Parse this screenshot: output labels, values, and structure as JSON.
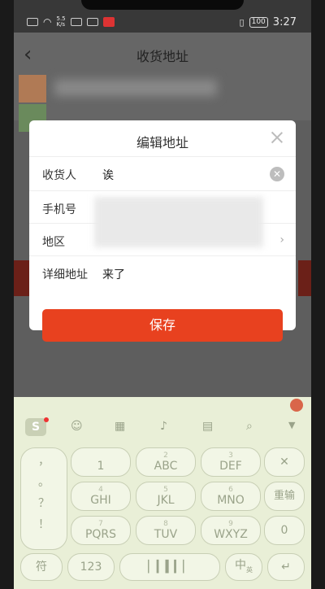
{
  "status_bar": {
    "net_speed_top": "5.5",
    "net_speed_bottom": "K/s",
    "battery": "100",
    "time": "3:27"
  },
  "page": {
    "title": "收货地址",
    "back_icon": "chevron-left-icon"
  },
  "dialog": {
    "title": "编辑地址",
    "fields": [
      {
        "label": "收货人",
        "value": "诶"
      },
      {
        "label": "手机号",
        "value": ""
      },
      {
        "label": "地区",
        "value": ""
      },
      {
        "label": "详细地址",
        "value": "来了"
      }
    ],
    "save_label": "保存"
  },
  "keyboard": {
    "toolbar": [
      "emoji-icon",
      "keyboard-icon",
      "mic-icon",
      "apps-icon",
      "search-icon",
      "collapse-icon"
    ],
    "keys": {
      "punct": [
        "，",
        "。",
        "？",
        "！"
      ],
      "k1": "1",
      "k2_letters": "ABC",
      "k2_num": "2",
      "k3_letters": "DEF",
      "k3_num": "3",
      "delete": "✕",
      "k4_letters": "GHI",
      "k4_num": "4",
      "k5_letters": "JKL",
      "k5_num": "5",
      "k6_letters": "MNO",
      "k6_num": "6",
      "reenter": "重输",
      "k7_letters": "PQRS",
      "k7_num": "7",
      "k8_letters": "TUV",
      "k8_num": "8",
      "k9_letters": "WXYZ",
      "k9_num": "9",
      "zero": "0",
      "symbols": "符",
      "num123": "123",
      "lang_main": "中",
      "lang_sub": "英",
      "enter": "↵"
    }
  },
  "colors": {
    "accent": "#e8411f",
    "keyboard_bg": "#e9efd7"
  }
}
